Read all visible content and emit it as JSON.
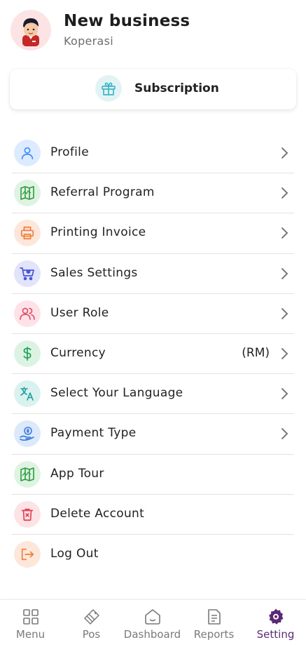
{
  "header": {
    "business_name": "New business",
    "business_type": "Koperasi"
  },
  "subscription": {
    "label": "Subscription",
    "icon": "gift-icon"
  },
  "menu": {
    "items": [
      {
        "label": "Profile",
        "icon": "user-icon",
        "color": "#3d8bfd",
        "bg": "#dcebff",
        "chevron": true
      },
      {
        "label": "Referral Program",
        "icon": "map-icon",
        "color": "#2e9a3e",
        "bg": "#dff3e2",
        "chevron": true
      },
      {
        "label": "Printing Invoice",
        "icon": "printer-icon",
        "color": "#f07d3a",
        "bg": "#fde7da",
        "chevron": true
      },
      {
        "label": "Sales Settings",
        "icon": "cart-icon",
        "color": "#4a55d6",
        "bg": "#e1e4fb",
        "chevron": true
      },
      {
        "label": "User Role",
        "icon": "users-icon",
        "color": "#e0506a",
        "bg": "#fde2e7",
        "chevron": true
      },
      {
        "label": "Currency",
        "value": "(RM)",
        "icon": "dollar-icon",
        "color": "#22a55a",
        "bg": "#dcf3e4",
        "chevron": true
      },
      {
        "label": "Select Your Language",
        "icon": "translate-icon",
        "color": "#1f9e9e",
        "bg": "#d9f2f0",
        "chevron": true
      },
      {
        "label": "Payment Type",
        "icon": "coin-hand-icon",
        "color": "#3d7bd9",
        "bg": "#dce9fb",
        "chevron": true
      },
      {
        "label": "App Tour",
        "icon": "map-icon",
        "color": "#2e9a3e",
        "bg": "#dff3e2",
        "chevron": false
      },
      {
        "label": "Delete Account",
        "icon": "trash-icon",
        "color": "#e0404f",
        "bg": "#fde3e5",
        "chevron": false
      },
      {
        "label": "Log Out",
        "icon": "logout-icon",
        "color": "#f07d3a",
        "bg": "#fde7da",
        "chevron": false
      }
    ]
  },
  "bottom_nav": {
    "items": [
      {
        "label": "Menu",
        "icon": "grid-icon"
      },
      {
        "label": "Pos",
        "icon": "card-icon"
      },
      {
        "label": "Dashboard",
        "icon": "home-icon"
      },
      {
        "label": "Reports",
        "icon": "document-icon"
      },
      {
        "label": "Setting",
        "icon": "gear-icon",
        "active": true
      }
    ],
    "active_color": "#5b2a74"
  }
}
